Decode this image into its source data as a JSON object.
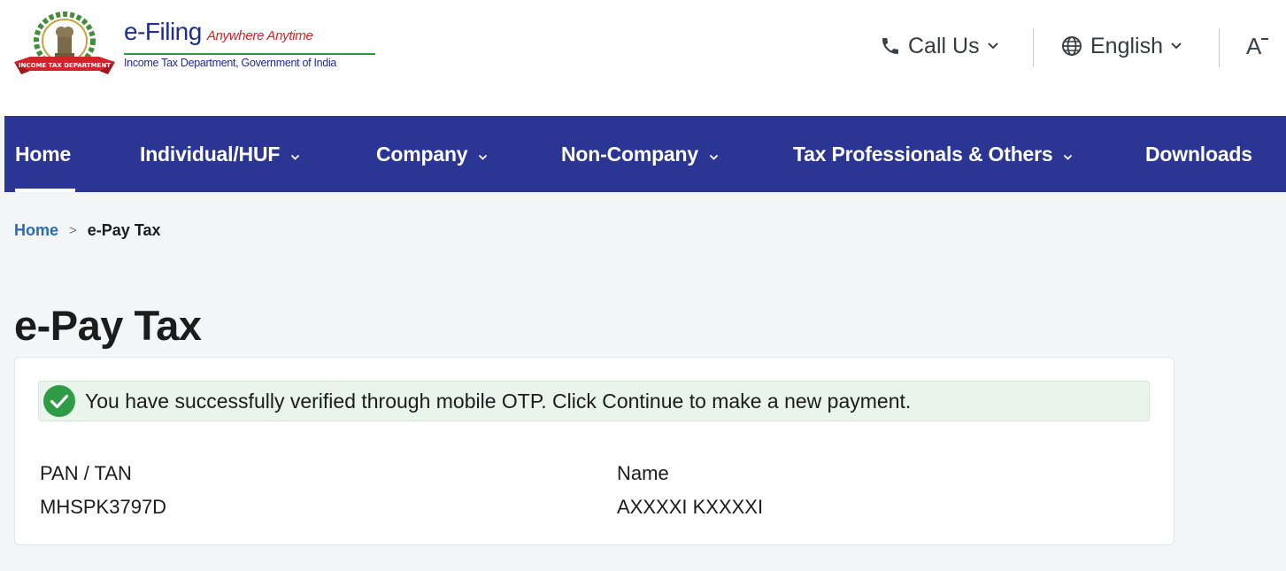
{
  "header": {
    "logo_alt": "INCOME TAX DEPARTMENT",
    "brand_title": "e-Filing",
    "brand_tagline": "Anywhere Anytime",
    "brand_subtitle": "Income Tax Department, Government of India",
    "call_us_label": "Call Us",
    "language_label": "English",
    "font_size_icon": "A"
  },
  "nav": {
    "items": [
      {
        "label": "Home",
        "active": true,
        "has_dropdown": false
      },
      {
        "label": "Individual/HUF",
        "has_dropdown": true
      },
      {
        "label": "Company",
        "has_dropdown": true
      },
      {
        "label": "Non-Company",
        "has_dropdown": true
      },
      {
        "label": "Tax Professionals & Others",
        "has_dropdown": true
      },
      {
        "label": "Downloads",
        "has_dropdown": false
      }
    ]
  },
  "breadcrumb": {
    "home": "Home",
    "separator": ">",
    "current": "e-Pay Tax"
  },
  "page": {
    "title": "e-Pay Tax"
  },
  "card": {
    "alert_message": "You have successfully verified through mobile OTP. Click Continue to make a new payment.",
    "pan_label": "PAN / TAN",
    "pan_value": "MHSPK3797D",
    "name_label": "Name",
    "name_value": "AXXXXI KXXXXI"
  },
  "colors": {
    "nav_bg": "#2b3593",
    "brand_blue": "#1e2d8f",
    "brand_red": "#d2232a",
    "success_green": "#2e9b45",
    "link_blue": "#2b6cb0"
  }
}
